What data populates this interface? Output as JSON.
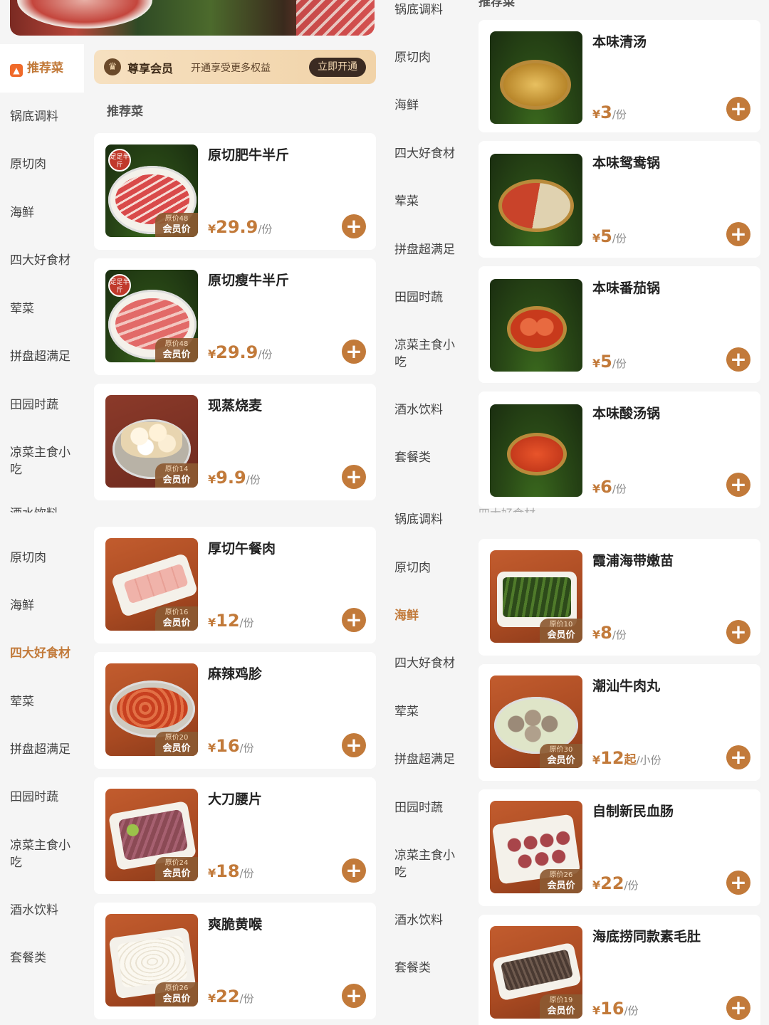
{
  "member": {
    "title": "尊享会员",
    "subtitle": "开通享受更多权益",
    "button": "立即开通"
  },
  "left_sidebar": {
    "items": [
      {
        "label": "推荐菜",
        "active": true
      },
      {
        "label": "锅底调料"
      },
      {
        "label": "原切肉"
      },
      {
        "label": "海鲜"
      },
      {
        "label": "四大好食材"
      },
      {
        "label": "荤菜"
      },
      {
        "label": "拼盘超满足"
      },
      {
        "label": "田园时蔬"
      },
      {
        "label": "凉菜主食小吃"
      },
      {
        "label": "酒水饮料"
      },
      {
        "label": "原切肉"
      },
      {
        "label": "海鲜"
      },
      {
        "label": "四大好食材",
        "active": true
      },
      {
        "label": "荤菜"
      },
      {
        "label": "拼盘超满足"
      },
      {
        "label": "田园时蔬"
      },
      {
        "label": "凉菜主食小吃"
      },
      {
        "label": "酒水饮料"
      },
      {
        "label": "套餐类"
      }
    ]
  },
  "left_section_title": "推荐菜",
  "left_products": [
    {
      "name": "原切肥牛半斤",
      "price": "29.9",
      "unit": "/份",
      "orig": "原价48",
      "member_label": "会员价",
      "stamp": "足足半斤"
    },
    {
      "name": "原切瘦牛半斤",
      "price": "29.9",
      "unit": "/份",
      "orig": "原价48",
      "member_label": "会员价",
      "stamp": "足足半斤"
    },
    {
      "name": "现蒸烧麦",
      "price": "9.9",
      "unit": "/份",
      "orig": "原价14",
      "member_label": "会员价"
    },
    {
      "name": "厚切午餐肉",
      "price": "12",
      "unit": "/份",
      "orig": "原价16",
      "member_label": "会员价"
    },
    {
      "name": "麻辣鸡胗",
      "price": "16",
      "unit": "/份",
      "orig": "原价20",
      "member_label": "会员价"
    },
    {
      "name": "大刀腰片",
      "price": "18",
      "unit": "/份",
      "orig": "原价24",
      "member_label": "会员价"
    },
    {
      "name": "爽脆黄喉",
      "price": "22",
      "unit": "/份",
      "orig": "原价26",
      "member_label": "会员价"
    }
  ],
  "right_sidebar": {
    "items": [
      {
        "label": "锅底调料"
      },
      {
        "label": "原切肉"
      },
      {
        "label": "海鲜"
      },
      {
        "label": "四大好食材"
      },
      {
        "label": "荤菜"
      },
      {
        "label": "拼盘超满足"
      },
      {
        "label": "田园时蔬"
      },
      {
        "label": "凉菜主食小吃"
      },
      {
        "label": "酒水饮料"
      },
      {
        "label": "套餐类"
      },
      {
        "label": "锅底调料"
      },
      {
        "label": "原切肉"
      },
      {
        "label": "海鲜",
        "active": true
      },
      {
        "label": "四大好食材"
      },
      {
        "label": "荤菜"
      },
      {
        "label": "拼盘超满足"
      },
      {
        "label": "田园时蔬"
      },
      {
        "label": "凉菜主食小吃"
      },
      {
        "label": "酒水饮料"
      },
      {
        "label": "套餐类"
      }
    ]
  },
  "right_section_title": "推荐菜",
  "right_mid_title": "四大好食材",
  "right_products": [
    {
      "name": "本味清汤",
      "price": "3",
      "unit": "/份"
    },
    {
      "name": "本味鸳鸯锅",
      "price": "5",
      "unit": "/份"
    },
    {
      "name": "本味番茄锅",
      "price": "5",
      "unit": "/份"
    },
    {
      "name": "本味酸汤锅",
      "price": "6",
      "unit": "/份"
    },
    {
      "name": "霞浦海带嫩苗",
      "price": "8",
      "unit": "/份",
      "orig": "原价10",
      "member_label": "会员价"
    },
    {
      "name": "潮汕牛肉丸",
      "price": "12",
      "qi": "起",
      "unit": "/小份",
      "orig": "原价30",
      "member_label": "会员价"
    },
    {
      "name": "自制新民血肠",
      "price": "22",
      "unit": "/份",
      "orig": "原价26",
      "member_label": "会员价"
    },
    {
      "name": "海底捞同款素毛肚",
      "price": "16",
      "unit": "/份",
      "orig": "原价19",
      "member_label": "会员价"
    }
  ],
  "currency": "¥",
  "accent": "#c27a3a",
  "icons": [
    "crown-icon",
    "flame-icon",
    "plus-icon"
  ]
}
